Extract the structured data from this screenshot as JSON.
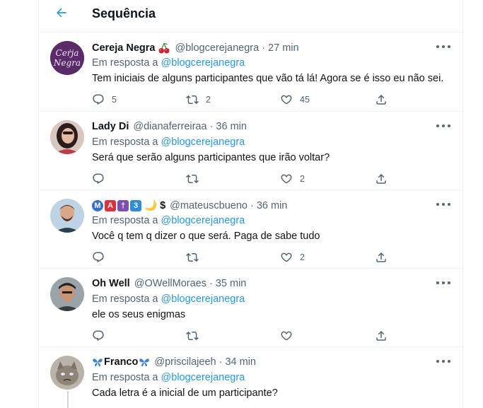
{
  "header": {
    "title": "Sequência"
  },
  "colors": {
    "accent": "#1d9bf0",
    "text": "#0f1419",
    "secondary": "#536471",
    "divider": "#eff3f4"
  },
  "tweets": [
    {
      "name": "Cereja Negra",
      "name_emoji": "cherries-icon",
      "handle": "@blogcerejanegra",
      "time": "27 min",
      "reply_prefix": "Em resposta a",
      "reply_to": "@blogcerejanegra",
      "text": "Tem iniciais de alguns participantes que vão tá lá! Agora se é isso eu não sei.",
      "replies": "5",
      "retweets": "2",
      "likes": "45",
      "avatar_text": "Cereja Negra"
    },
    {
      "name": "Lady Di",
      "handle": "@dianaferreiraa",
      "time": "36 min",
      "reply_prefix": "Em resposta a",
      "reply_to": "@blogcerejanegra",
      "text": "Será que serão alguns participantes que irão voltar?",
      "replies": "",
      "retweets": "",
      "likes": "2"
    },
    {
      "name_badges": [
        "M",
        "A",
        "†",
        "3"
      ],
      "name_suffix": "🌙 $",
      "handle": "@mateuscbueno",
      "time": "36 min",
      "reply_prefix": "Em resposta a",
      "reply_to": "@blogcerejanegra",
      "text": "Você q tem q dizer o que será. Paga de sabe tudo",
      "replies": "",
      "retweets": "",
      "likes": "2"
    },
    {
      "name": "Oh Well",
      "handle": "@OWellMoraes",
      "time": "35 min",
      "reply_prefix": "Em resposta a",
      "reply_to": "@blogcerejanegra",
      "text": "ele os seus enigmas",
      "replies": "",
      "retweets": "",
      "likes": ""
    },
    {
      "name": "Franco",
      "name_emoji": "butterfly-icon",
      "handle": "@priscilajeeh",
      "time": "34 min",
      "reply_prefix": "Em resposta a",
      "reply_to": "@blogcerejanegra",
      "text": "Cada letra é a inicial de um participante?"
    }
  ]
}
